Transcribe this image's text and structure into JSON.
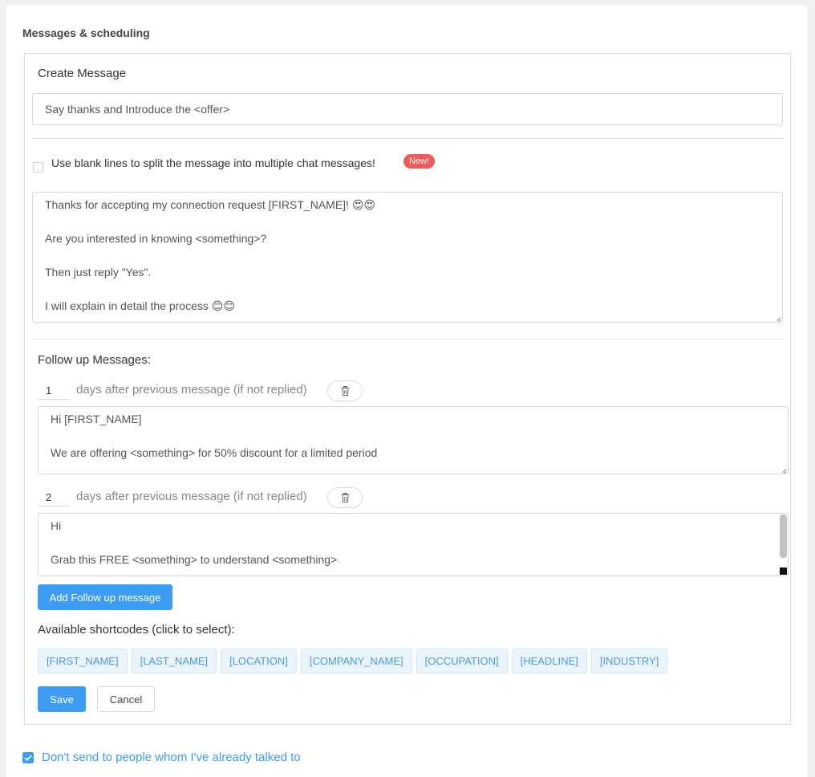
{
  "section": {
    "title": "Messages & scheduling"
  },
  "create": {
    "heading": "Create Message",
    "subject_value": "Say thanks and Introduce the <offer>"
  },
  "split": {
    "checked": false,
    "label": "Use blank lines to split the message into multiple chat messages!",
    "badge": "New!"
  },
  "message_body": {
    "lines": [
      "Thanks for accepting my connection request [FIRST_NAME]! 😍😍",
      "",
      "Are you interested in knowing <something>?",
      "",
      "Then just reply \"Yes\".",
      "",
      "I will explain in detail the process 😊😊"
    ]
  },
  "followups": {
    "heading": "Follow up Messages:",
    "items": [
      {
        "days": "1",
        "days_label": "days after previous message (if not replied)",
        "lines": [
          "Hi [FIRST_NAME]",
          "",
          "We are offering <something> for 50% discount for a limited period"
        ]
      },
      {
        "days": "2",
        "days_label": "days after previous message (if not replied)",
        "lines": [
          "Hi",
          "",
          "Grab this FREE <something> to understand <something>"
        ]
      }
    ],
    "add_button": "Add Follow up message"
  },
  "shortcodes": {
    "heading": "Available shortcodes (click to select):",
    "items": [
      "[FIRST_NAME]",
      "[LAST_NAME]",
      "[LOCATION]",
      "[COMPANY_NAME]",
      "[OCCUPATION]",
      "[HEADLINE]",
      "[INDUSTRY]"
    ]
  },
  "actions": {
    "save": "Save",
    "cancel": "Cancel"
  },
  "dont_send": {
    "checked": true,
    "label": "Don't send to people whom I've already talked to"
  },
  "colors": {
    "accent": "#3d9df5",
    "badge": "#f05a5a",
    "shortcode_bg": "#eaf4fd",
    "shortcode_text": "#4a9be0"
  },
  "icons": {
    "trash": "trash-icon",
    "check": "check-icon"
  }
}
